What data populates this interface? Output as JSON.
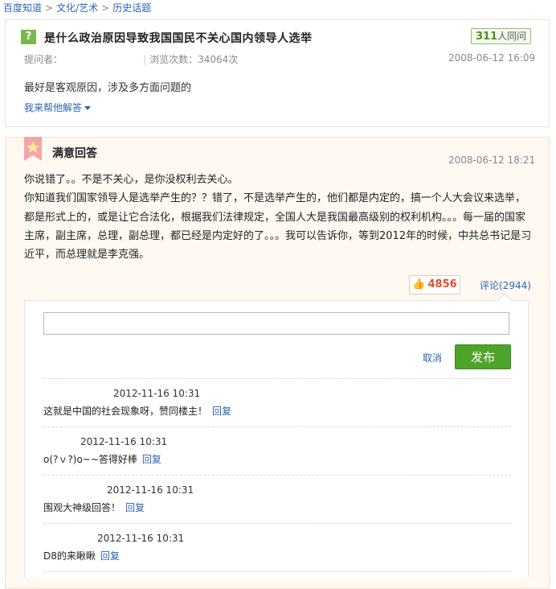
{
  "breadcrumb": {
    "items": [
      "百度知道",
      "文化/艺术",
      "历史话题"
    ],
    "separator": ">"
  },
  "question": {
    "badge": "?",
    "title": "是什么政治原因导致我国国民不关心国内领导人选举",
    "same_ask_count": "311",
    "same_ask_suffix": "人同问",
    "asker_label": "提问者：",
    "views": "浏览次数：34064次",
    "time": "2008-06-12 16:09",
    "description": "最好是客观原因，涉及多方面问题的",
    "help_answer_label": "我来帮他解答"
  },
  "answer": {
    "heading": "满意回答",
    "time": "2008-06-12 18:21",
    "paragraphs": [
      "你说错了。。不是不关心，是你没权利去关心。",
      "你知道我们国家领导人是选举产生的？？错了，不是选举产生的，他们都是内定的，搞一个人大会议来选举，都是形式上的，或是让它合法化，根据我们法律规定，全国人大是我国最高级别的权利机构。。。每一届的国家主席，副主席，总理，副总理，都已经是内定好的了。。。我可以告诉你，等到2012年的时候，中共总书记是习近平，而总理就是李克强。"
    ],
    "likes": "4856",
    "comments_label": "评论(2944)"
  },
  "comment_form": {
    "input_value": "",
    "cancel_label": "取消",
    "publish_label": "发布"
  },
  "comments": [
    {
      "time": "2012-11-16 10:31",
      "text": "这就是中国的社会现象呀，赞同楼主！",
      "reply_label": "回复"
    },
    {
      "time": "2012-11-16 10:31",
      "text": "o(?ｖ?)o~~答得好棒",
      "reply_label": "回复"
    },
    {
      "time": "2012-11-16 10:31",
      "text": "围观大神级回答！",
      "reply_label": "回复"
    },
    {
      "time": "2012-11-16 10:31",
      "text": "D8的来瞅瞅",
      "reply_label": "回复"
    }
  ],
  "colors": {
    "link": "#2d64b3",
    "accent_green": "#4ea42a",
    "like_red": "#e05030",
    "answer_bg": "#fff9f2"
  }
}
